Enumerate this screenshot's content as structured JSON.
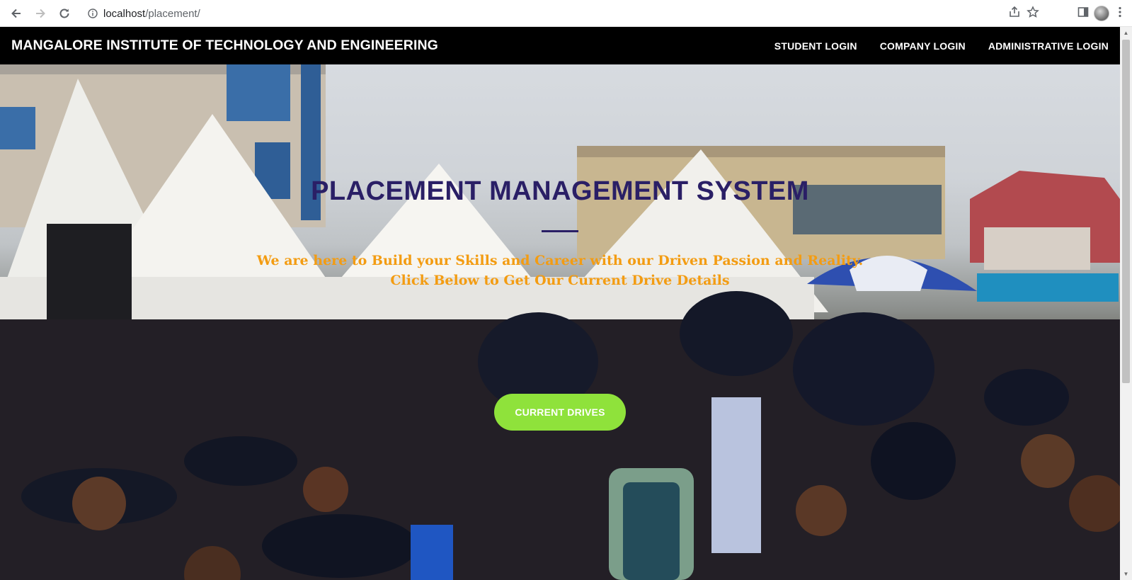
{
  "browser": {
    "url_host": "localhost",
    "url_path": "/placement/"
  },
  "header": {
    "brand": "MANGALORE INSTITUTE OF TECHNOLOGY AND ENGINEERING",
    "nav": [
      {
        "label": "STUDENT LOGIN"
      },
      {
        "label": "COMPANY LOGIN"
      },
      {
        "label": "ADMINISTRATIVE LOGIN"
      }
    ]
  },
  "hero": {
    "title": "PLACEMENT MANAGEMENT SYSTEM",
    "tagline_line1": "We are here to Build your Skills and Career with our Driven Passion and Reality.",
    "tagline_line2": "Click Below to Get Our Current Drive Details",
    "cta_label": "CURRENT DRIVES"
  },
  "colors": {
    "header_bg": "#000000",
    "title": "#2a1f66",
    "tagline": "#f39c12",
    "cta": "#8fe23b"
  }
}
